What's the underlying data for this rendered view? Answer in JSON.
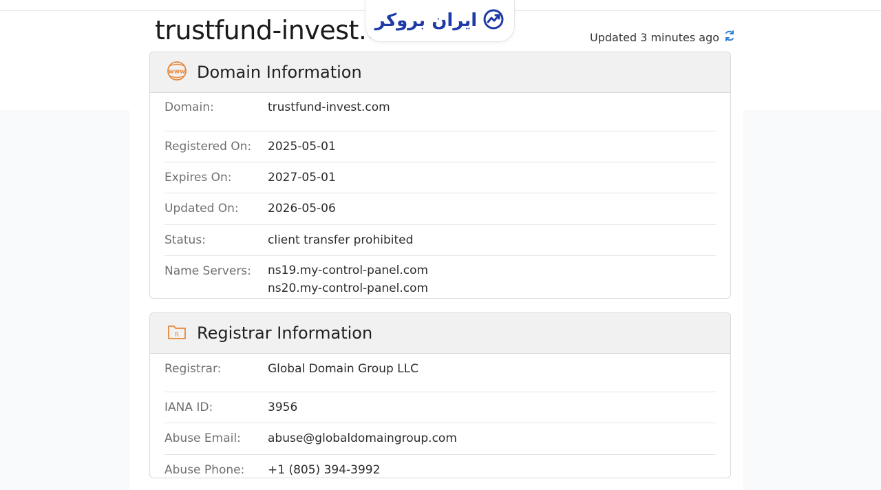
{
  "page": {
    "title": "trustfund-invest.com",
    "updated": "Updated 3 minutes ago",
    "logo_text": "ایران بروکر"
  },
  "domain_info": {
    "heading": "Domain Information",
    "icon": "www-icon",
    "rows": [
      {
        "label": "Domain:",
        "values": [
          "trustfund-invest.com"
        ]
      },
      {
        "label": "Registered On:",
        "values": [
          "2025-05-01"
        ]
      },
      {
        "label": "Expires On:",
        "values": [
          "2027-05-01"
        ]
      },
      {
        "label": "Updated On:",
        "values": [
          "2026-05-06"
        ]
      },
      {
        "label": "Status:",
        "values": [
          "client transfer prohibited"
        ]
      },
      {
        "label": "Name Servers:",
        "values": [
          "ns19.my-control-panel.com",
          "ns20.my-control-panel.com"
        ]
      }
    ]
  },
  "registrar_info": {
    "heading": "Registrar Information",
    "icon": "registrar-folder-icon",
    "rows": [
      {
        "label": "Registrar:",
        "values": [
          "Global Domain Group LLC"
        ]
      },
      {
        "label": "IANA ID:",
        "values": [
          "3956"
        ]
      },
      {
        "label": "Abuse Email:",
        "values": [
          "abuse@globaldomaingroup.com"
        ]
      },
      {
        "label": "Abuse Phone:",
        "values": [
          "+1 (805) 394-3992"
        ]
      }
    ]
  },
  "colors": {
    "accent_orange": "#e8883a",
    "logo_blue": "#1d3aa8",
    "refresh_blue": "#2f7fd6"
  }
}
